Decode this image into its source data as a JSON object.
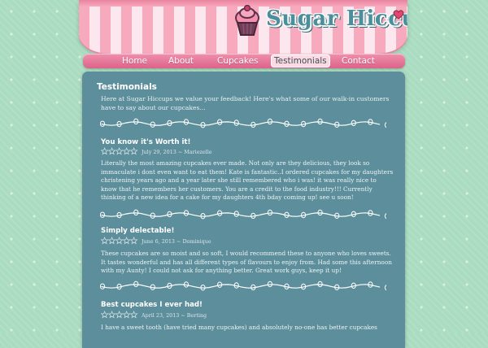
{
  "header": {
    "logo_text": "Sugar Hiccups",
    "logo_icon": "cupcake-icon"
  },
  "nav": {
    "items": [
      {
        "label": "Home"
      },
      {
        "label": "About"
      },
      {
        "label": "Cupcakes"
      },
      {
        "label": "Testimonials",
        "active": true
      },
      {
        "label": "Contact"
      }
    ]
  },
  "page": {
    "title": "Testimonials",
    "intro": "Here at Sugar Hiccups we value your feedback! Here's what some of our walk-in customers have to say about our cupcakes..."
  },
  "testimonials": [
    {
      "title": "You know it's Worth it!",
      "date": "July 29, 2013",
      "author": "Mariezelle",
      "body": "Literally the most amazing cupcakes ever made. Not only are they delicious, they look so immaculate i dont even want to eat them! Kate is fantastic..I ordered cupcakes for my daughters christening years ago and a year later she still remembered who i was! it was really nice to know that he remembers her customers. You are a credit to the food industry!!! Currently thinking of a new idea for a cake for my daughters 4th bday coming up! see u soon!"
    },
    {
      "title": "Simply delectable!",
      "date": "June 6, 2013",
      "author": "Dominique",
      "body": "These cupcakes are so moist and so soft, I would recommend these to anyone who loves sweets. It tastes wonderful and has all different types of flavours to enjoy from. Had some this afternoon with my Aunty! I could not ask for anything better. Great work guys, keep it up!"
    },
    {
      "title": "Best cupcakes I ever had!",
      "date": "April 23, 2013",
      "author": "Berting",
      "body": "I have a sweet tooth (have tried many cupcakes) and absolutely no-one has better cupcakes"
    }
  ],
  "colors": {
    "background": "#a9dcc0",
    "panel": "#5d8e9b",
    "nav": "#e36f93",
    "awning_stripe": "#f7a9bd",
    "logo_text": "#4a8f9b"
  }
}
